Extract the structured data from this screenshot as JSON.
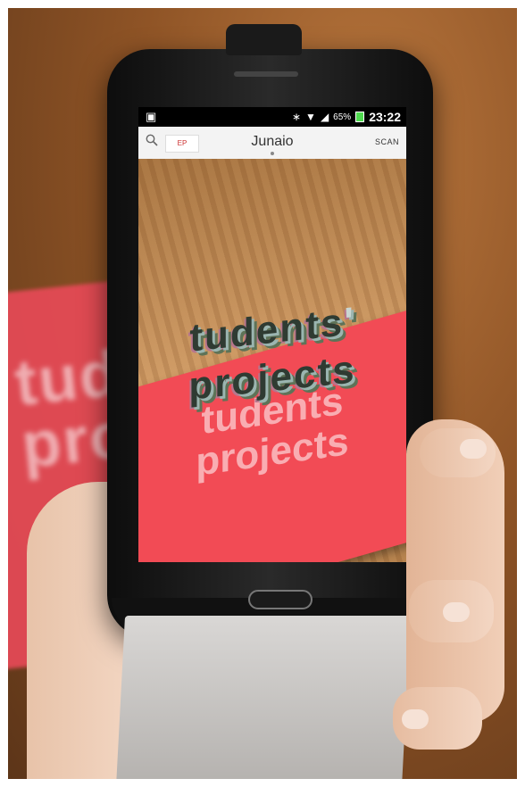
{
  "status_bar": {
    "battery_percent": "65%",
    "time": "23:22"
  },
  "app_bar": {
    "title": "Junaio",
    "scan_label": "SCAN",
    "logo_text": "EP"
  },
  "camera": {
    "ar_text_line1": "tudents",
    "ar_apostrophe": "'",
    "ar_text_line2": "projects",
    "card_text_line1": "tudents",
    "card_text_line2": "projects"
  },
  "background": {
    "card_text_line1": "tudents",
    "card_text_line2": "projects"
  }
}
